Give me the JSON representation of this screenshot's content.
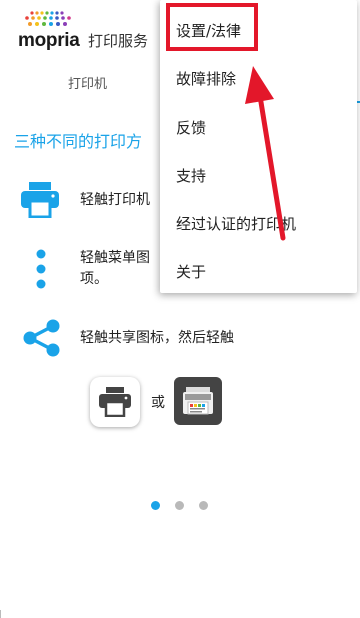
{
  "header": {
    "logo_text": "mopria",
    "app_title": "打印服务",
    "tab_printers": "打印机"
  },
  "main": {
    "headline": "三种不同的打印方",
    "steps": [
      {
        "icon": "printer-icon",
        "text": "轻触打印机"
      },
      {
        "icon": "more-vert-icon",
        "text_line1": "轻触菜单图",
        "text_line2": "项。"
      },
      {
        "icon": "share-icon",
        "text": "轻触共享图标，然后轻触"
      }
    ],
    "or_text": "或",
    "pager": {
      "count": 3,
      "active_index": 0
    }
  },
  "menu": {
    "items": [
      {
        "label": "设置/法律",
        "highlighted": true
      },
      {
        "label": "故障排除"
      },
      {
        "label": "反馈"
      },
      {
        "label": "支持"
      },
      {
        "label": "经过认证的打印机"
      },
      {
        "label": "关于"
      }
    ]
  },
  "colors": {
    "accent": "#1aa3e8",
    "annotation_red": "#e3172a"
  }
}
